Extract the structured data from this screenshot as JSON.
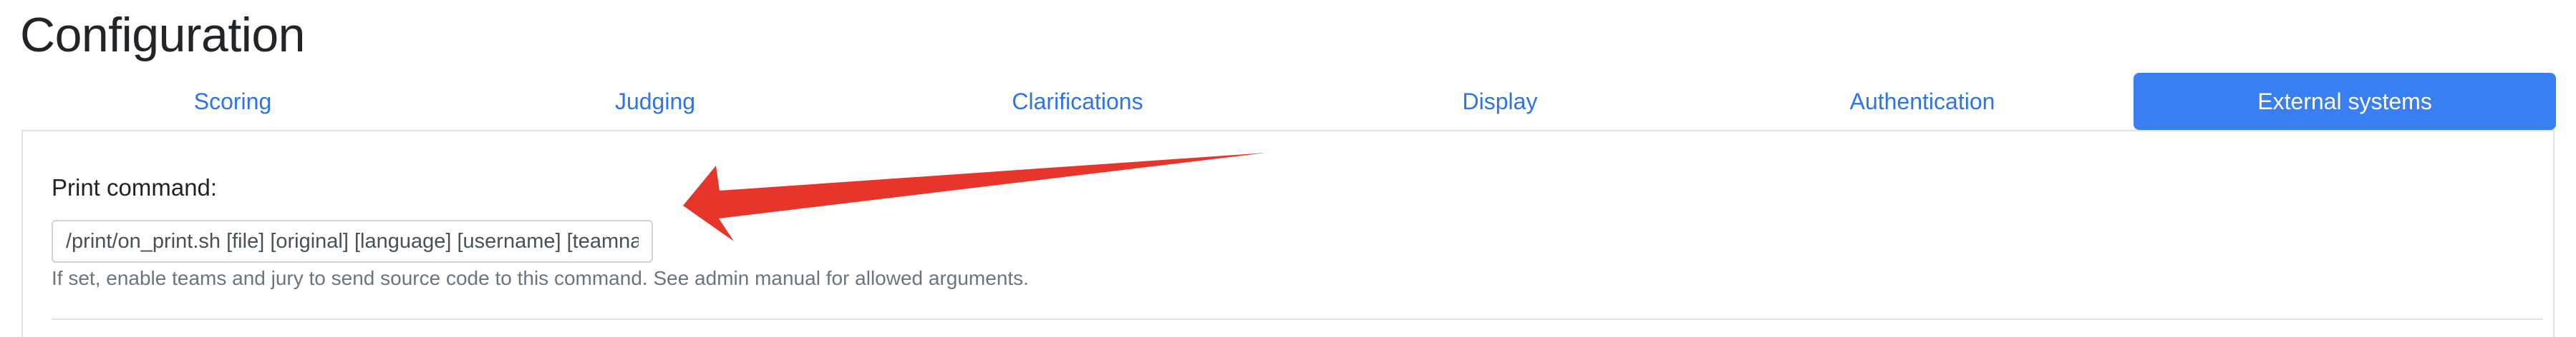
{
  "page": {
    "title": "Configuration"
  },
  "tabs": [
    {
      "label": "Scoring",
      "active": false
    },
    {
      "label": "Judging",
      "active": false
    },
    {
      "label": "Clarifications",
      "active": false
    },
    {
      "label": "Display",
      "active": false
    },
    {
      "label": "Authentication",
      "active": false
    },
    {
      "label": "External systems",
      "active": true
    }
  ],
  "print_command": {
    "label": "Print command:",
    "value": "/print/on_print.sh [file] [original] [language] [username] [teamname] [teamid] [location]",
    "help": "If set, enable teams and jury to send source code to this command. See admin manual for allowed arguments."
  },
  "colors": {
    "accent": "#3a7ff2",
    "link": "#2f74e6",
    "annotation_arrow": "#e8352b"
  }
}
